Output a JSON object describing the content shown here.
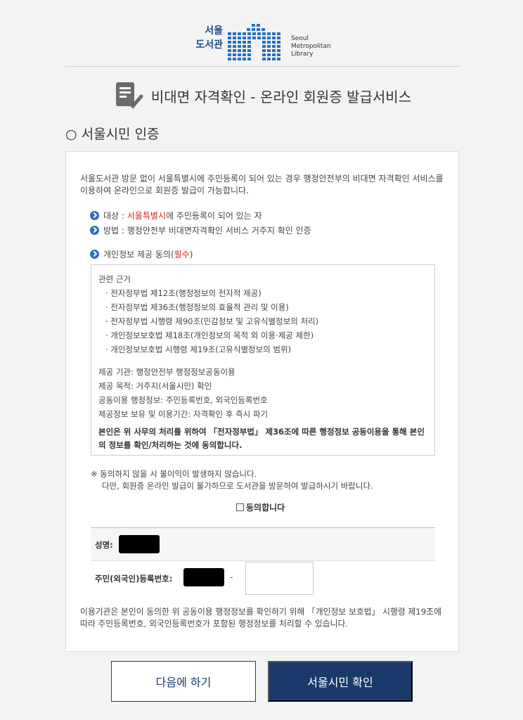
{
  "logo": {
    "ko_line1": "서울",
    "ko_line2": "도서관",
    "en_line1": "Seoul",
    "en_line2": "Metropolitan",
    "en_line3": "Library",
    "brand_color": "#2a6fbd"
  },
  "page_title": "비대면 자격확인 - 온라인 회원증 발급서비스",
  "section_title": "○ 서울시민 인증",
  "intro_text": "서울도서관 방문 없이 서울특별시에 주민등록이 되어 있는 경우 행정안전부의 비대면 자격확인 서비스를 이용하여 온라인으로 회원증 발급이 가능합니다.",
  "target": {
    "prefix": "대상 : ",
    "highlight": "서울특별시",
    "suffix": "에 주민등록이 되어 있는 자"
  },
  "method": "방법 : 행정안전부 비대면자격확인 서비스 거주지 확인 인증",
  "consent_heading": {
    "prefix": "개인정보 제공 동의(",
    "required": "필수",
    "suffix": ")"
  },
  "terms": {
    "basis_title": "관련 근거",
    "laws": [
      "· 전자정부법 제12조(행정정보의 전자적 제공)",
      "· 전자정부법 제36조(행정정보의 효율적 관리 및 이용)",
      "· 전자정부법 시행령 제90조(민감정보 및 고유식별정보의 처리)",
      "· 개인정보보호법 제18조(개인정보의 목적 외 이용·제공 제한)",
      "· 개인정보보호법 시행령 제19조(고유식별정보의 범위)"
    ],
    "provider": "제공 기관: 행정안전부 행정정보공동이용",
    "purpose": "제공 목적: 거주지(서울시민) 확인",
    "shared_info": "공동이용 행정정보: 주민등록번호, 외국인등록번호",
    "retention": "제공정보 보유 및 이용기간: 자격확인 후 즉시 파기",
    "statement": "본인은 위 사무의 처리를 위하여 「전자정부법」 제36조에 따른 행정정보 공동이용을 통해 본인의 정보를 확인/처리하는 것에 동의합니다."
  },
  "notice_line1": "※ 동의하지 않을 시 불이익이 발생하지 않습니다.",
  "notice_line2": "다만, 회원증 온라인 발급이 불가하므로 도서관을 방문하여 발급하시기 바랍니다.",
  "agree_label": "동의합니다",
  "form": {
    "name_label": "성명:",
    "ssn_label": "주민(외국인)등록번호:",
    "ssn_separator": "-"
  },
  "footer_note": "이용기관은 본인이 동의한 위 공동이용 행정정보를 확인하기 위해 「개인정보 보호법」 시행령 제19조에 따라 주민등록번호, 외국인등록번호가 포함된 행정정보를 처리할 수 있습니다.",
  "buttons": {
    "later": "다음에 하기",
    "confirm": "서울시민 확인"
  },
  "colors": {
    "primary": "#1b3a6b",
    "accent": "#2a6fbd",
    "required": "#e02020"
  }
}
